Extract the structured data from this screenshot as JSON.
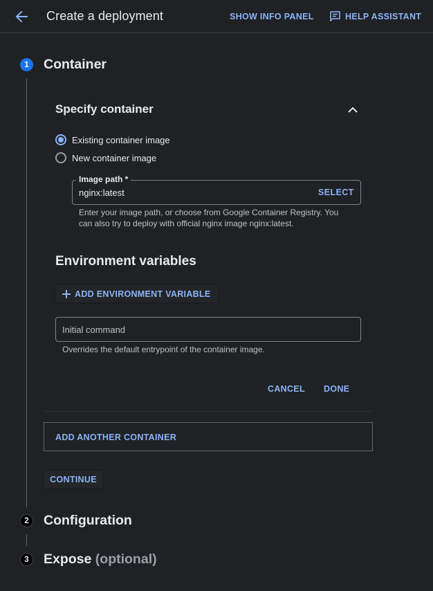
{
  "header": {
    "title": "Create a deployment",
    "show_info_panel": "SHOW INFO PANEL",
    "help_assistant": "HELP ASSISTANT"
  },
  "steps": [
    {
      "number": "1",
      "title": "Container",
      "optional": ""
    },
    {
      "number": "2",
      "title": "Configuration",
      "optional": ""
    },
    {
      "number": "3",
      "title": "Expose",
      "optional": "(optional)"
    }
  ],
  "container_panel": {
    "title": "Specify container",
    "radio_options": [
      {
        "label": "Existing container image",
        "checked": true
      },
      {
        "label": "New container image",
        "checked": false
      }
    ],
    "image_path": {
      "label": "Image path *",
      "value": "nginx:latest",
      "select_label": "SELECT",
      "hint": "Enter your image path, or choose from Google Container Registry. You can also try to deploy with official nginx image nginx:latest."
    },
    "env_title": "Environment variables",
    "add_env_label": "ADD ENVIRONMENT VARIABLE",
    "initial_command": {
      "placeholder": "Initial command",
      "hint": "Overrides the default entrypoint of the container image."
    },
    "cancel_label": "CANCEL",
    "done_label": "DONE"
  },
  "add_container_label": "ADD ANOTHER CONTAINER",
  "continue_label": "CONTINUE",
  "colors": {
    "background": "#202124",
    "accent": "#8ab4f8",
    "step_active": "#1a73e8",
    "text": "#e8eaed",
    "muted": "#9aa0a6"
  },
  "icons": {
    "back": "arrow-back-icon",
    "help": "feedback-chat-icon",
    "collapse": "chevron-up-icon",
    "add": "plus-icon"
  }
}
